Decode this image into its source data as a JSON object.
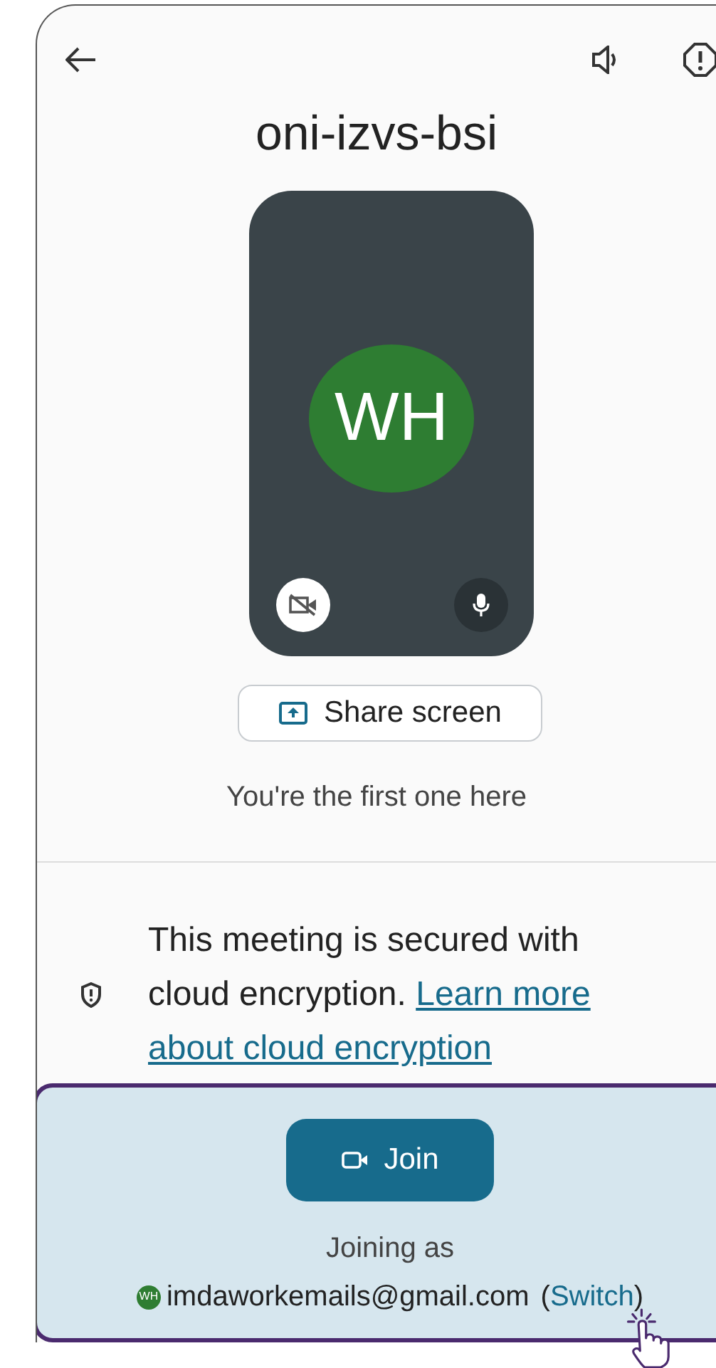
{
  "meeting_code": "oni-izvs-bsi",
  "preview": {
    "initials": "WH",
    "camera_on": false,
    "mic_on": true
  },
  "share_button": {
    "label": "Share screen"
  },
  "status_text": "You're the first one here",
  "security": {
    "text": "This meeting is secured with cloud encryption. ",
    "link_lines": [
      "Learn more",
      "about cloud encryption"
    ]
  },
  "join": {
    "button": "Join",
    "joining_label": "Joining as",
    "avatar_initials": "WH",
    "email": "imdaworkemails@gmail.com",
    "paren_open": "(",
    "switch_link": "Switch",
    "paren_close": ")"
  }
}
